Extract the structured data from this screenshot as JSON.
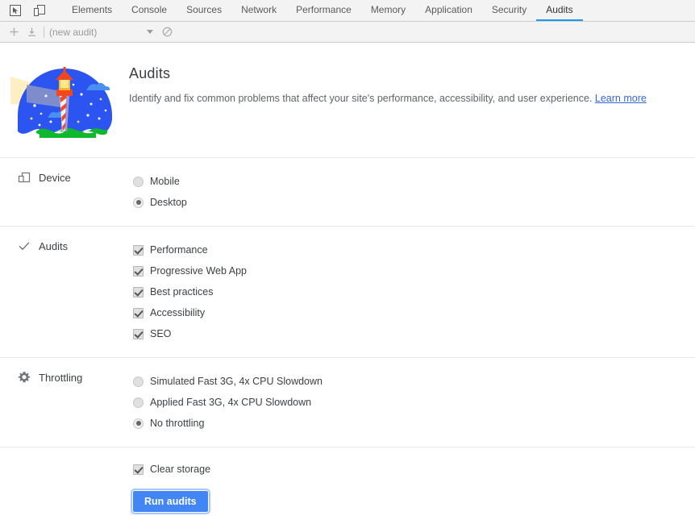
{
  "devtools": {
    "toolbar_icons": [
      {
        "name": "inspect-element-icon",
        "title": "Inspect element"
      },
      {
        "name": "device-toolbar-icon",
        "title": "Toggle device toolbar"
      }
    ],
    "tabs": [
      {
        "label": "Elements",
        "active": false
      },
      {
        "label": "Console",
        "active": false
      },
      {
        "label": "Sources",
        "active": false
      },
      {
        "label": "Network",
        "active": false
      },
      {
        "label": "Performance",
        "active": false
      },
      {
        "label": "Memory",
        "active": false
      },
      {
        "label": "Application",
        "active": false
      },
      {
        "label": "Security",
        "active": false
      },
      {
        "label": "Audits",
        "active": true
      }
    ],
    "accent_color": "#1a9bf0"
  },
  "actionbar": {
    "add_icon": "plus-icon",
    "import_icon": "import-download-icon",
    "audit_select_value": "(new audit)",
    "clear_icon": "clear-no-entry-icon"
  },
  "hero": {
    "logo_name": "lighthouse-logo",
    "title": "Audits",
    "description": "Identify and fix common problems that affect your site's performance, accessibility, and user experience.",
    "learn_more_label": "Learn more"
  },
  "sections": {
    "device": {
      "icon": "device-icon",
      "label": "Device",
      "options": [
        {
          "label": "Mobile",
          "checked": false
        },
        {
          "label": "Desktop",
          "checked": true
        }
      ]
    },
    "audits": {
      "icon": "check-icon",
      "label": "Audits",
      "options": [
        {
          "label": "Performance",
          "checked": true
        },
        {
          "label": "Progressive Web App",
          "checked": true
        },
        {
          "label": "Best practices",
          "checked": true
        },
        {
          "label": "Accessibility",
          "checked": true
        },
        {
          "label": "SEO",
          "checked": true
        }
      ]
    },
    "throttling": {
      "icon": "gear-icon",
      "label": "Throttling",
      "options": [
        {
          "label": "Simulated Fast 3G, 4x CPU Slowdown",
          "checked": false
        },
        {
          "label": "Applied Fast 3G, 4x CPU Slowdown",
          "checked": false
        },
        {
          "label": "No throttling",
          "checked": true
        }
      ]
    },
    "final": {
      "clear_storage_label": "Clear storage",
      "clear_storage_checked": true,
      "run_button_label": "Run audits",
      "run_button_color": "#4285f4"
    }
  }
}
